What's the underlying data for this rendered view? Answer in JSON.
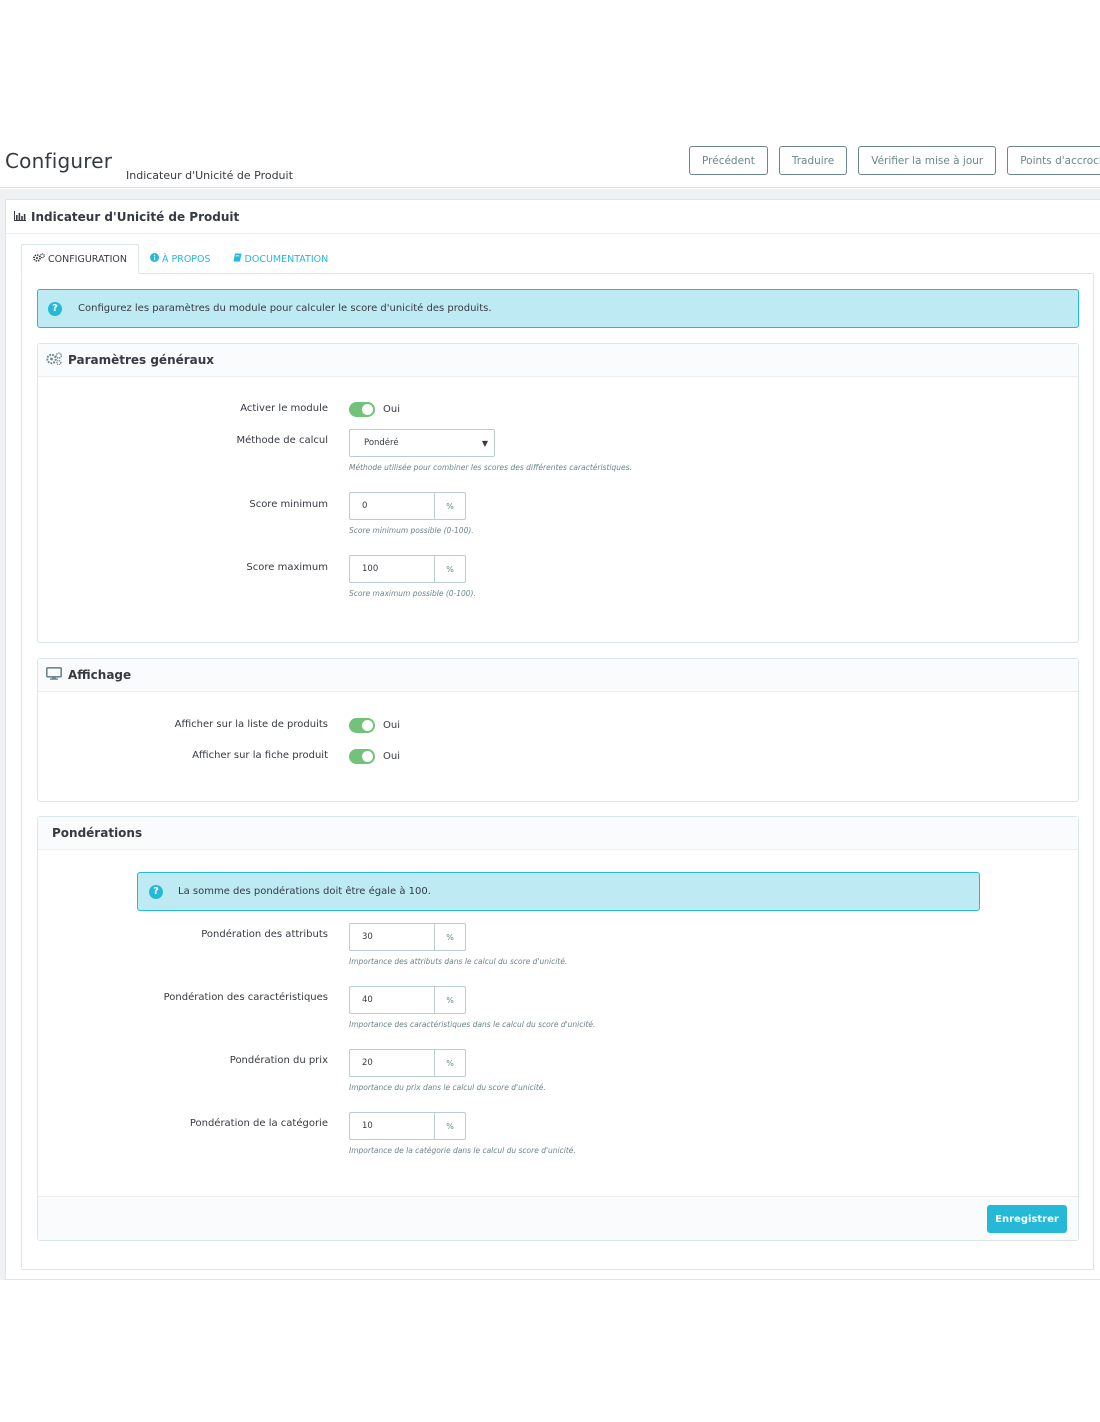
{
  "header": {
    "title": "Configurer",
    "subtitle": "Indicateur d'Unicité de Produit",
    "toolbar": [
      "Précédent",
      "Traduire",
      "Vérifier la mise à jour",
      "Points d'accroche"
    ]
  },
  "panel": {
    "title": "Indicateur d'Unicité de Produit",
    "icon": "bar-chart-icon"
  },
  "tabs": [
    {
      "label": "CONFIGURATION",
      "icon": "cogs-icon",
      "active": true
    },
    {
      "label": "À PROPOS",
      "icon": "info-icon",
      "active": false
    },
    {
      "label": "DOCUMENTATION",
      "icon": "book-icon",
      "active": false
    }
  ],
  "intro_alert": "Configurez les paramètres du module pour calculer le score d'unicité des produits.",
  "general": {
    "title": "Paramètres généraux",
    "enable_label": "Activer le module",
    "enable_value": "Oui",
    "method_label": "Méthode de calcul",
    "method_value": "Pondéré",
    "method_help": "Méthode utilisée pour combiner les scores des différentes caractéristiques.",
    "min_label": "Score minimum",
    "min_value": "0",
    "min_help": "Score minimum possible (0-100).",
    "max_label": "Score maximum",
    "max_value": "100",
    "max_help": "Score maximum possible (0-100).",
    "unit": "%"
  },
  "display": {
    "title": "Affichage",
    "list_label": "Afficher sur la liste de produits",
    "list_value": "Oui",
    "page_label": "Afficher sur la fiche produit",
    "page_value": "Oui"
  },
  "weights": {
    "title": "Pondérations",
    "alert": "La somme des pondérations doit être égale à 100.",
    "unit": "%",
    "items": [
      {
        "label": "Pondération des attributs",
        "value": "30",
        "help": "Importance des attributs dans le calcul du score d'unicité."
      },
      {
        "label": "Pondération des caractéristiques",
        "value": "40",
        "help": "Importance des caractéristiques dans le calcul du score d'unicité."
      },
      {
        "label": "Pondération du prix",
        "value": "20",
        "help": "Importance du prix dans le calcul du score d'unicité."
      },
      {
        "label": "Pondération de la catégorie",
        "value": "10",
        "help": "Importance de la catégorie dans le calcul du score d'unicité."
      }
    ],
    "save_label": "Enregistrer"
  },
  "colors": {
    "accent": "#25b9d7",
    "switch_on": "#72c279",
    "alert_bg": "#beeaf3"
  }
}
